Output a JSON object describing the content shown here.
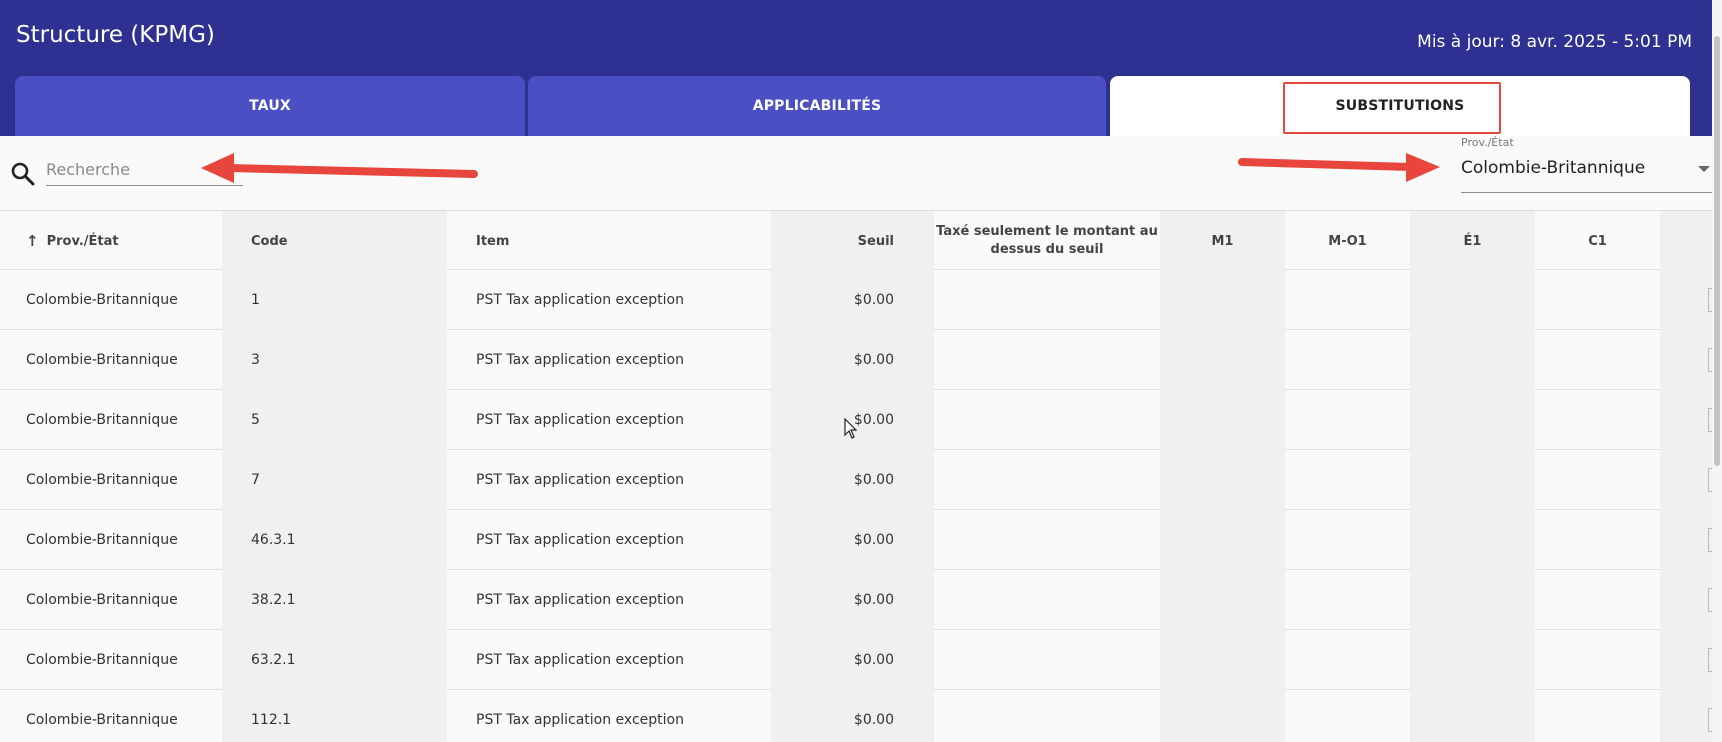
{
  "header": {
    "title": "Structure (KPMG)",
    "updated": "Mis à jour: 8 avr. 2025 - 5:01 PM",
    "brand_color": "#2e3192"
  },
  "tabs": [
    {
      "label": "TAUX",
      "active": false
    },
    {
      "label": "APPLICABILITÉS",
      "active": false
    },
    {
      "label": "SUBSTITUTIONS",
      "active": true
    }
  ],
  "search": {
    "placeholder": "Recherche",
    "value": "",
    "icon": "search-icon"
  },
  "filter": {
    "label": "Prov./État",
    "value": "Colombie-Britannique"
  },
  "table": {
    "columns": [
      "Prov./État",
      "Code",
      "Item",
      "Seuil",
      "Taxé seulement le montant au dessus du seuil",
      "M1",
      "M-O1",
      "É1",
      "C1"
    ],
    "sort": {
      "column": "Prov./État",
      "direction": "asc",
      "icon": "arrow-up-icon"
    },
    "rows": [
      {
        "prov": "Colombie-Britannique",
        "code": "1",
        "item": "PST Tax application exception",
        "seuil": "$0.00"
      },
      {
        "prov": "Colombie-Britannique",
        "code": "3",
        "item": "PST Tax application exception",
        "seuil": "$0.00"
      },
      {
        "prov": "Colombie-Britannique",
        "code": "5",
        "item": "PST Tax application exception",
        "seuil": "$0.00"
      },
      {
        "prov": "Colombie-Britannique",
        "code": "7",
        "item": "PST Tax application exception",
        "seuil": "$0.00"
      },
      {
        "prov": "Colombie-Britannique",
        "code": "46.3.1",
        "item": "PST Tax application exception",
        "seuil": "$0.00"
      },
      {
        "prov": "Colombie-Britannique",
        "code": "38.2.1",
        "item": "PST Tax application exception",
        "seuil": "$0.00"
      },
      {
        "prov": "Colombie-Britannique",
        "code": "63.2.1",
        "item": "PST Tax application exception",
        "seuil": "$0.00"
      },
      {
        "prov": "Colombie-Britannique",
        "code": "112.1",
        "item": "PST Tax application exception",
        "seuil": "$0.00"
      }
    ]
  },
  "annotation_color": "#e8453c"
}
